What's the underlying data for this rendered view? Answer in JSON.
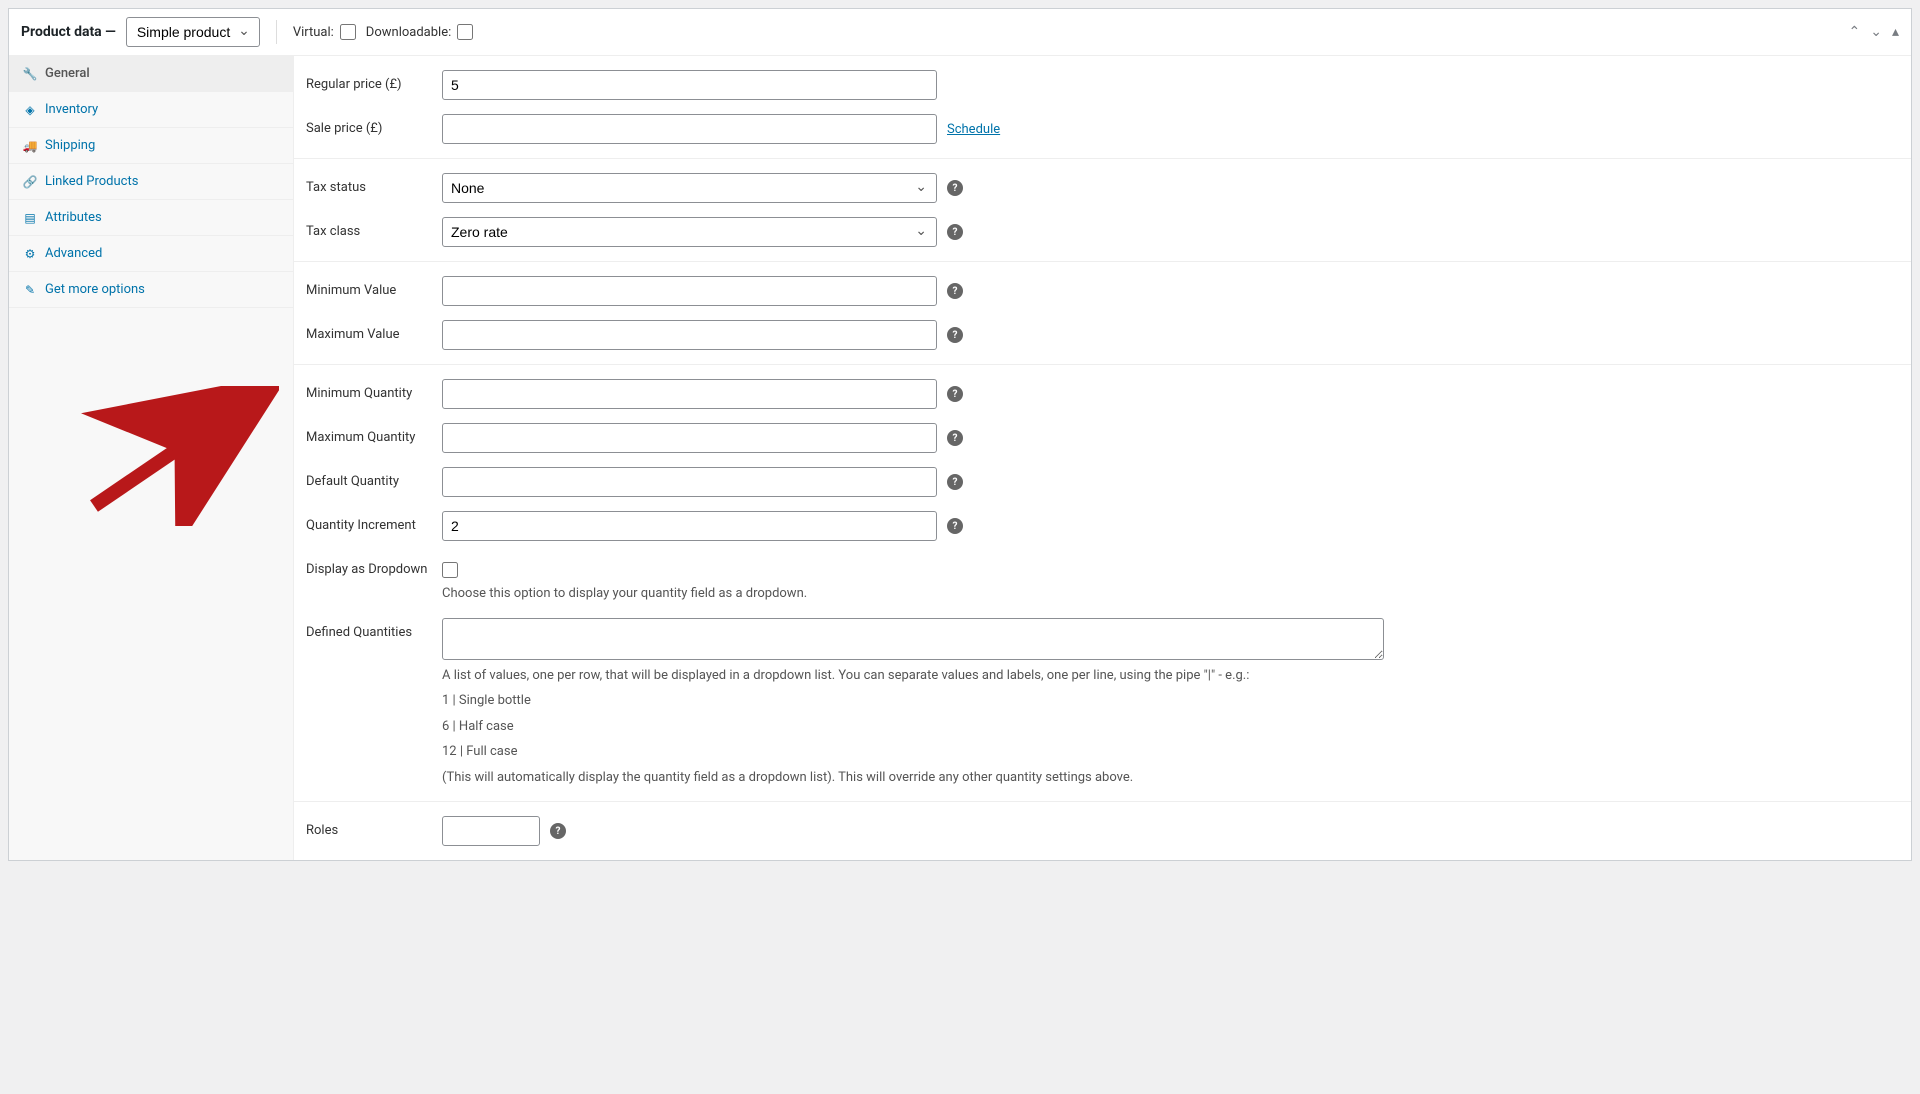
{
  "header": {
    "title": "Product data —",
    "product_type": "Simple product",
    "virtual_label": "Virtual:",
    "downloadable_label": "Downloadable:"
  },
  "sidebar": {
    "items": [
      {
        "label": "General",
        "icon": "🔧"
      },
      {
        "label": "Inventory",
        "icon": "◈"
      },
      {
        "label": "Shipping",
        "icon": "🚚"
      },
      {
        "label": "Linked Products",
        "icon": "🔗"
      },
      {
        "label": "Attributes",
        "icon": "▤"
      },
      {
        "label": "Advanced",
        "icon": "⚙"
      },
      {
        "label": "Get more options",
        "icon": "✎"
      }
    ]
  },
  "fields": {
    "regular_price_label": "Regular price (£)",
    "regular_price_value": "5",
    "sale_price_label": "Sale price (£)",
    "schedule_link": "Schedule",
    "tax_status_label": "Tax status",
    "tax_status_value": "None",
    "tax_class_label": "Tax class",
    "tax_class_value": "Zero rate",
    "min_value_label": "Minimum Value",
    "max_value_label": "Maximum Value",
    "min_qty_label": "Minimum Quantity",
    "max_qty_label": "Maximum Quantity",
    "default_qty_label": "Default Quantity",
    "qty_increment_label": "Quantity Increment",
    "qty_increment_value": "2",
    "display_dropdown_label": "Display as Dropdown",
    "display_dropdown_desc": "Choose this option to display your quantity field as a dropdown.",
    "defined_qty_label": "Defined Quantities",
    "defined_qty_desc_1": "A list of values, one per row, that will be displayed in a dropdown list. You can separate values and labels, one per line, using the pipe \"|\" - e.g.:",
    "defined_qty_ex_1": "1 | Single bottle",
    "defined_qty_ex_2": "6 | Half case",
    "defined_qty_ex_3": "12 | Full case",
    "defined_qty_desc_2": "(This will automatically display the quantity field as a dropdown list). This will override any other quantity settings above.",
    "roles_label": "Roles"
  }
}
